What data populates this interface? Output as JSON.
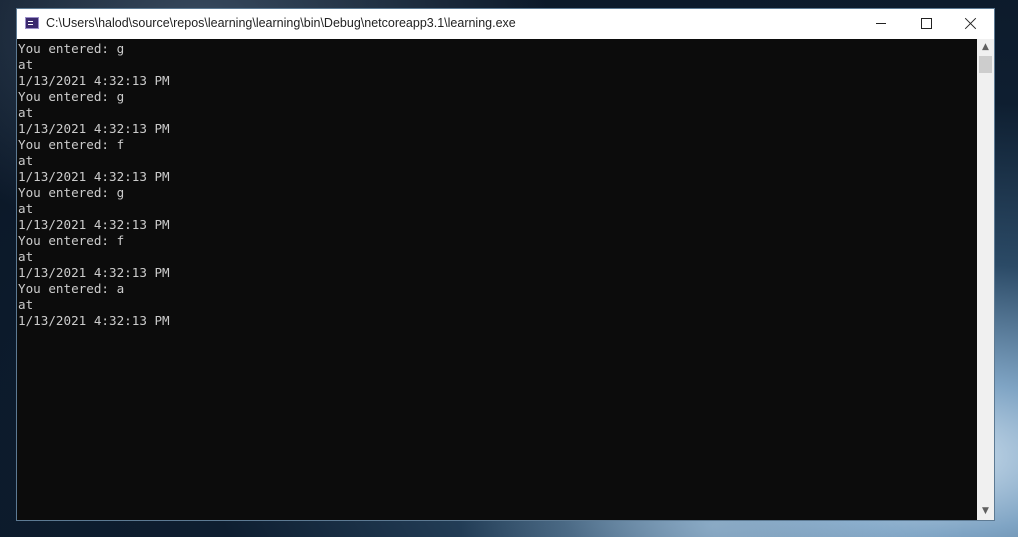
{
  "window": {
    "title": "C:\\Users\\halod\\source\\repos\\learning\\learning\\bin\\Debug\\netcoreapp3.1\\learning.exe",
    "icon": "console-app-icon",
    "controls": {
      "minimize": "minimize-icon",
      "maximize": "maximize-icon",
      "close": "close-icon"
    }
  },
  "console": {
    "lines": [
      "You entered: g",
      "at",
      "1/13/2021 4:32:13 PM",
      "You entered: g",
      "at",
      "1/13/2021 4:32:13 PM",
      "You entered: f",
      "at",
      "1/13/2021 4:32:13 PM",
      "You entered: g",
      "at",
      "1/13/2021 4:32:13 PM",
      "You entered: f",
      "at",
      "1/13/2021 4:32:13 PM",
      "You entered: a",
      "at",
      "1/13/2021 4:32:13 PM"
    ],
    "colors": {
      "background": "#0c0c0c",
      "text": "#cccccc"
    }
  },
  "scrollbar": {
    "up_arrow": "▲",
    "down_arrow": "▼"
  }
}
